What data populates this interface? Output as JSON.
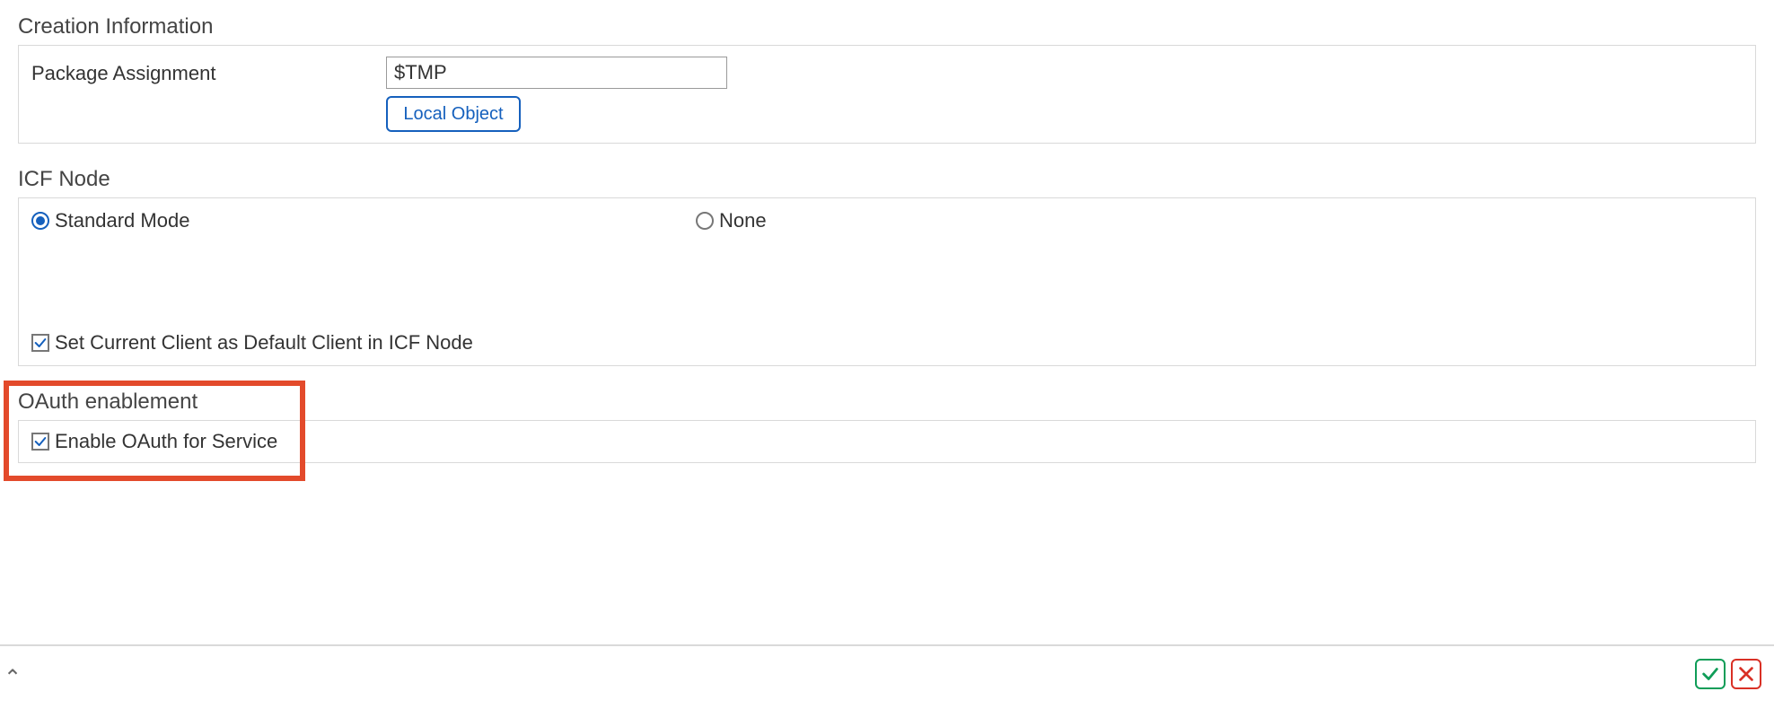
{
  "creation_info": {
    "title": "Creation Information",
    "package_label": "Package Assignment",
    "package_value": "$TMP",
    "local_object_btn": "Local Object"
  },
  "icf_node": {
    "title": "ICF Node",
    "standard_mode_label": "Standard Mode",
    "standard_mode_selected": true,
    "none_label": "None",
    "none_selected": false,
    "default_client_label": "Set Current Client as Default Client in ICF Node",
    "default_client_checked": true
  },
  "oauth": {
    "title": "OAuth enablement",
    "enable_label": "Enable OAuth for Service",
    "enable_checked": true
  },
  "footer": {
    "ok_title": "Continue",
    "cancel_title": "Cancel"
  }
}
